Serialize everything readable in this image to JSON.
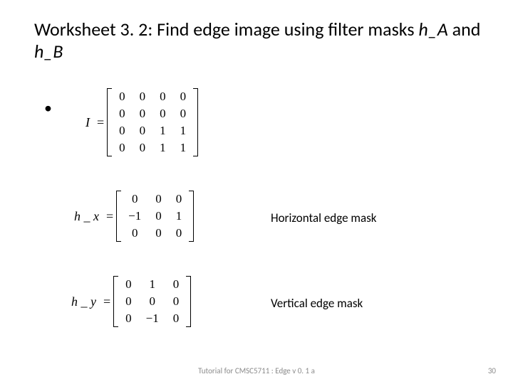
{
  "title_part1": "Worksheet 3. 2: Find edge image using filter masks ",
  "title_hA": "h_A",
  "title_and": " and ",
  "title_hB": "h_B",
  "I": {
    "label": "I",
    "rows": [
      [
        "0",
        "0",
        "0",
        "0"
      ],
      [
        "0",
        "0",
        "0",
        "0"
      ],
      [
        "0",
        "0",
        "1",
        "1"
      ],
      [
        "0",
        "0",
        "1",
        "1"
      ]
    ]
  },
  "hx": {
    "label": "h _ x",
    "rows": [
      [
        "0",
        "0",
        "0"
      ],
      [
        "−1",
        "0",
        "1"
      ],
      [
        "0",
        "0",
        "0"
      ]
    ],
    "note": "Horizontal edge mask"
  },
  "hy": {
    "label": "h _ y",
    "rows": [
      [
        "0",
        "1",
        "0"
      ],
      [
        "0",
        "0",
        "0"
      ],
      [
        "0",
        "−1",
        "0"
      ]
    ],
    "note": "Vertical edge mask"
  },
  "footer_center": "Tutorial for CMSC5711 : Edge v 0. 1 a",
  "footer_right": "30",
  "chart_data": {
    "type": "table",
    "title": "Worksheet 3.2 matrices",
    "series": [
      {
        "name": "I",
        "values": [
          [
            0,
            0,
            0,
            0
          ],
          [
            0,
            0,
            0,
            0
          ],
          [
            0,
            0,
            1,
            1
          ],
          [
            0,
            0,
            1,
            1
          ]
        ]
      },
      {
        "name": "h_x",
        "values": [
          [
            0,
            0,
            0
          ],
          [
            -1,
            0,
            1
          ],
          [
            0,
            0,
            0
          ]
        ],
        "note": "Horizontal edge mask"
      },
      {
        "name": "h_y",
        "values": [
          [
            0,
            1,
            0
          ],
          [
            0,
            0,
            0
          ],
          [
            0,
            -1,
            0
          ]
        ],
        "note": "Vertical edge mask"
      }
    ]
  }
}
